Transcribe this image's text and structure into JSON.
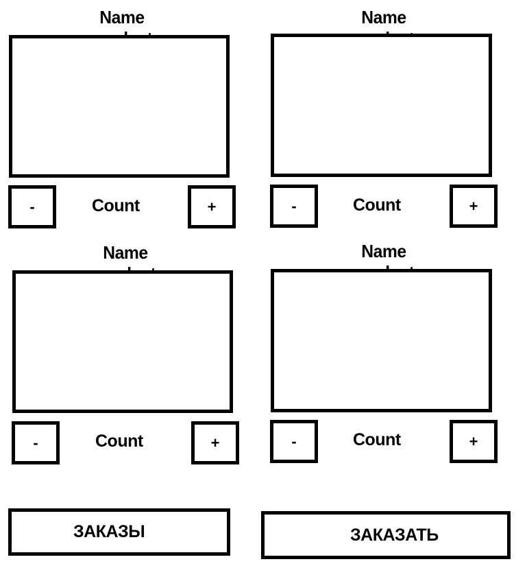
{
  "products": [
    {
      "name": "Name product",
      "minus_label": "-",
      "count_label": "Count",
      "plus_label": "+"
    },
    {
      "name": "Name product",
      "minus_label": "-",
      "count_label": "Count",
      "plus_label": "+"
    },
    {
      "name": "Name product",
      "minus_label": "-",
      "count_label": "Count",
      "plus_label": "+"
    },
    {
      "name": "Name product",
      "minus_label": "-",
      "count_label": "Count",
      "plus_label": "+"
    }
  ],
  "footer": {
    "orders_label": "ЗАКАЗЫ",
    "order_label": "ЗАКАЗАТЬ"
  }
}
